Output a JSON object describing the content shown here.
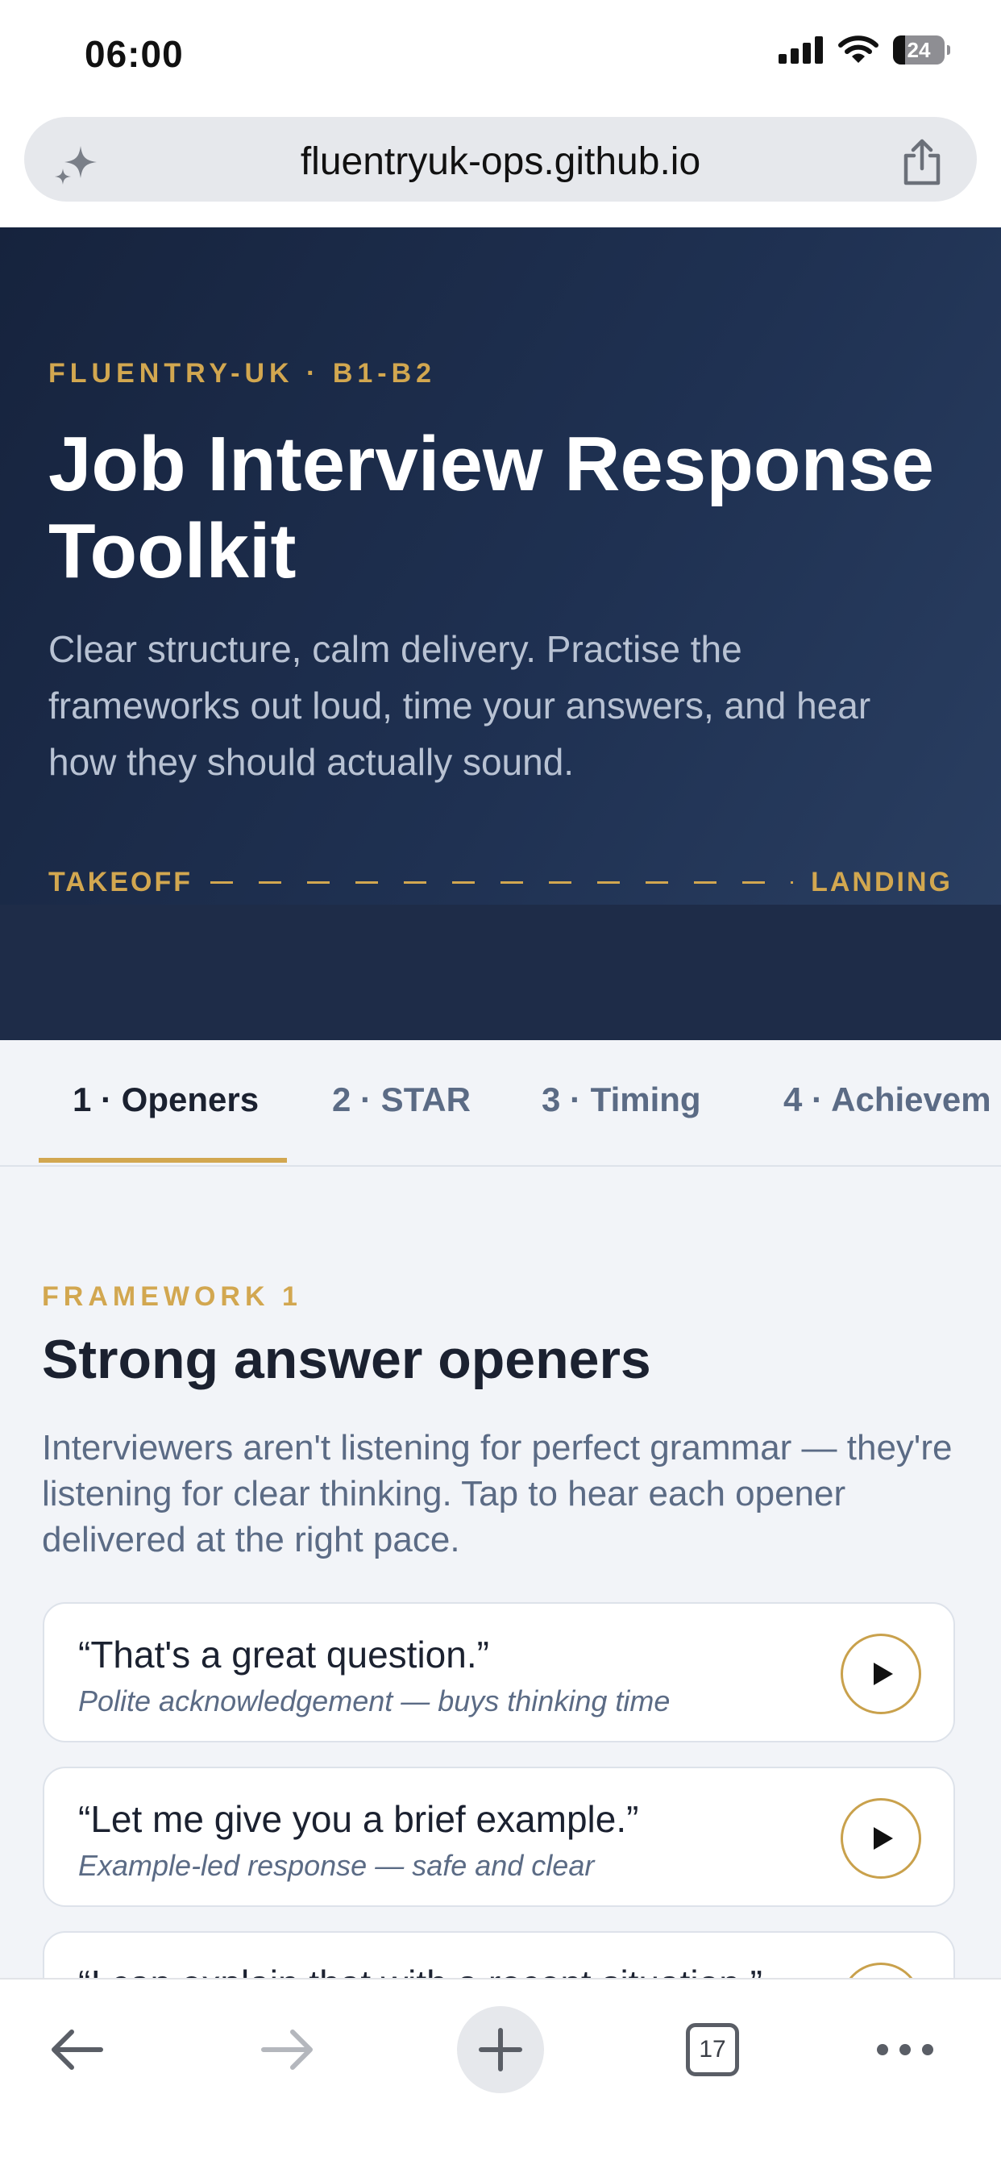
{
  "status_bar": {
    "time": "06:00",
    "battery": "24"
  },
  "browser": {
    "url": "fluentryuk-ops.github.io",
    "tab_count": "17"
  },
  "hero": {
    "eyebrow": "FLUENTRY-UK · B1-B2",
    "title": "Job Interview Response Toolkit",
    "subtitle": "Clear structure, calm delivery. Practise the frameworks out loud, time your answers, and hear how they should actually sound.",
    "journey_start": "TAKEOFF",
    "journey_end": "LANDING"
  },
  "tabs": [
    {
      "label": "1 · Openers",
      "active": true
    },
    {
      "label": "2 · STAR",
      "active": false
    },
    {
      "label": "3 · Timing",
      "active": false
    },
    {
      "label": "4 · Achievem",
      "active": false
    }
  ],
  "framework": {
    "eyebrow": "FRAMEWORK 1",
    "title": "Strong answer openers",
    "description": "Interviewers aren't listening for perfect grammar — they're listening for clear thinking. Tap to hear each opener delivered at the right pace.",
    "phrases": [
      {
        "text": "“That's a great question.”",
        "note": "Polite acknowledgement — buys thinking time"
      },
      {
        "text": "“Let me give you a brief example.”",
        "note": "Example-led response — safe and clear"
      },
      {
        "text": "“I can explain that with a recent situation.”",
        "note": ""
      }
    ]
  },
  "colors": {
    "accent": "#d2a750",
    "hero_bg": "#1f3152",
    "text_dark": "#1b2130",
    "text_muted": "#5b6b85"
  }
}
